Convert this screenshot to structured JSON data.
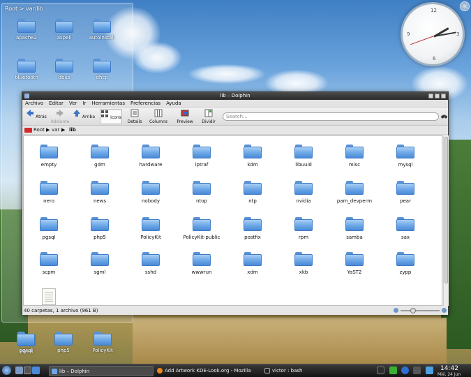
{
  "folderview": {
    "title": "Root > var/lib",
    "items": [
      {
        "label": "apache2"
      },
      {
        "label": "aspell"
      },
      {
        "label": "autoinstall"
      },
      {
        "label": "bluetooth"
      },
      {
        "label": "dbus"
      },
      {
        "label": "dhcp"
      }
    ]
  },
  "desktop": {
    "items": [
      {
        "label": "pgsql"
      },
      {
        "label": "php5"
      },
      {
        "label": "PolicyKit"
      }
    ]
  },
  "clock_widget": {
    "numerals": [
      "12",
      "3",
      "6",
      "9"
    ]
  },
  "window": {
    "title": "lib – Dolphin",
    "menu": [
      "Archivo",
      "Editar",
      "Ver",
      "Ir",
      "Herramientas",
      "Preferencias",
      "Ayuda"
    ],
    "toolbar": {
      "back": "Atrás",
      "forward": "Adelante",
      "up": "Arriba",
      "icons": "Icons",
      "details": "Details",
      "columns": "Columns",
      "preview": "Preview",
      "split": "Dividir"
    },
    "search_placeholder": "Search...",
    "breadcrumb": [
      "Root",
      "var",
      "lib"
    ],
    "files": [
      "empty",
      "gdm",
      "hardware",
      "iptraf",
      "kdm",
      "libuuid",
      "misc",
      "mysql",
      "nero",
      "news",
      "nobody",
      "ntop",
      "ntp",
      "nvidia",
      "pam_devperm",
      "pear",
      "pgsql",
      "php5",
      "PolicyKit",
      "PolicyKit-public",
      "postfix",
      "rpm",
      "samba",
      "sax",
      "scpm",
      "sgml",
      "sshd",
      "wwwrun",
      "xdm",
      "xkb",
      "YaST2",
      "zypp"
    ],
    "status": "40 carpetas, 1 archivo (961 B)"
  },
  "taskbar": {
    "tasks": [
      {
        "label": "lib – Dolphin",
        "active": true
      },
      {
        "label": "Add Artwork KDE-Look.org - Mozilla Firefox",
        "active": false
      },
      {
        "label": "victor : bash",
        "active": false
      }
    ],
    "time": "14:42",
    "date": "Mié, 24 Jun"
  },
  "colors": {
    "folder": "#6aa6e6",
    "titlebar": "#2a2a2a",
    "breadcrumb_icon": "#d4292c"
  }
}
